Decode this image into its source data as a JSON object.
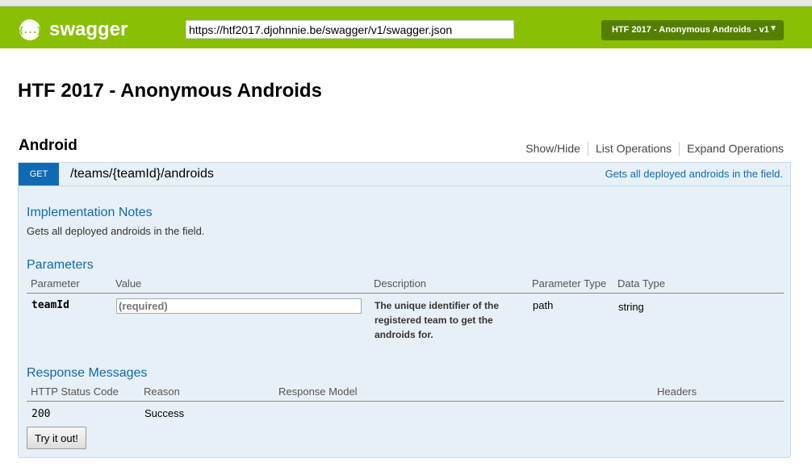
{
  "header": {
    "logo_glyph": "{...}",
    "logo_text": "swagger",
    "url_value": "https://htf2017.djohnnie.be/swagger/v1/swagger.json",
    "api_selector": "HTF 2017 - Anonymous Androids - v1",
    "brand_color": "#89bf04"
  },
  "page_title": "HTF 2017 - Anonymous Androids",
  "section": {
    "name": "Android",
    "links": [
      "Show/Hide",
      "List Operations",
      "Expand Operations"
    ]
  },
  "operation": {
    "method": "GET",
    "method_color": "#0f6ab4",
    "path": "/teams/{teamId}/androids",
    "summary": "Gets all deployed androids in the field.",
    "implementation_notes_title": "Implementation Notes",
    "implementation_notes": "Gets all deployed androids in the field.",
    "parameters_title": "Parameters",
    "parameter_headers": [
      "Parameter",
      "Value",
      "Description",
      "Parameter Type",
      "Data Type"
    ],
    "parameters": [
      {
        "name": "teamId",
        "placeholder": "(required)",
        "description": "The unique identifier of the registered team to get the androids for.",
        "param_type": "path",
        "data_type": "string"
      }
    ],
    "responses_title": "Response Messages",
    "response_headers": [
      "HTTP Status Code",
      "Reason",
      "Response Model",
      "Headers"
    ],
    "responses": [
      {
        "code": "200",
        "reason": "Success"
      }
    ],
    "try_button": "Try it out!"
  }
}
